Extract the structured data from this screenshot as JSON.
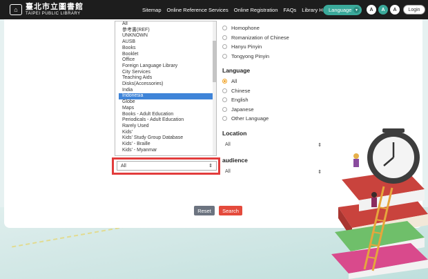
{
  "header": {
    "logo_cn": "臺北市立圖書館",
    "logo_en": "TAIPEI PUBLIC LIBRARY",
    "nav": [
      "Sitemap",
      "Online Reference Services",
      "Online Registration",
      "FAQs",
      "Library HOME"
    ],
    "language_button": "Language",
    "font_small": "A",
    "font_mid": "A",
    "font_large": "A",
    "login": "Login"
  },
  "type_list": {
    "items": [
      "All",
      "參考書(REF)",
      "UNKNOWN",
      "AUSB",
      "Books",
      "Booklet",
      "Office",
      "Foreign Language Library",
      "City Services",
      "Teaching Aids",
      "Disks(Accessories)",
      "India",
      "Indonesia",
      "Globe",
      "Maps",
      "Books - Adult Education",
      "Periodicals - Adult Education",
      "Rarely Used",
      "Kids'",
      "Kids' Study Group Database",
      "Kids' - Braille",
      "Kids' - Myanmar"
    ],
    "selected_index": 12,
    "select_value": "All"
  },
  "romanization": {
    "options": [
      "Homophone",
      "Romanization of Chinese",
      "Hanyu Pinyin",
      "Tongyong Pinyin"
    ]
  },
  "language": {
    "title": "Language",
    "options": [
      "All",
      "Chinese",
      "English",
      "Japanese",
      "Other Language"
    ],
    "selected_index": 0
  },
  "location": {
    "title": "Location",
    "value": "All"
  },
  "audience": {
    "title": "audience",
    "value": "All"
  },
  "buttons": {
    "reset": "Reset",
    "search": "Search"
  },
  "colors": {
    "header_bg": "#1d1d1d",
    "accent": "#3aa99a",
    "highlight": "#e23c3c",
    "selection": "#3f84d8",
    "search": "#e44a3c"
  }
}
